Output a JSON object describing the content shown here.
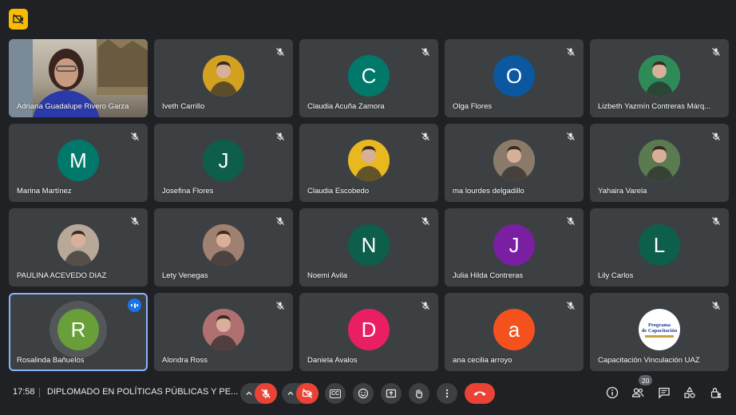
{
  "meeting": {
    "time": "17:58",
    "title": "DIPLOMADO EN POLÍTICAS PÚBLICAS Y PE...",
    "participant_count": "20"
  },
  "colors": {
    "background": "#202124",
    "tile": "#3c4043",
    "end_call": "#ea4335",
    "speaking_outline": "#8ab4f8",
    "speaking_badge": "#1a73e8"
  },
  "participants": [
    {
      "name": "Adriana Guadalupe Rivero Garza",
      "type": "video"
    },
    {
      "name": "Iveth Carrillo",
      "type": "photo",
      "photo_color": "#d4a020"
    },
    {
      "name": "Claudia Acuña Zamora",
      "type": "initial",
      "initial": "C",
      "color": "#00796b"
    },
    {
      "name": "Olga Flores",
      "type": "initial",
      "initial": "O",
      "color": "#0b57a0"
    },
    {
      "name": "Lizbeth Yazmín Contreras Márq...",
      "type": "photo",
      "photo_color": "#2e8b57"
    },
    {
      "name": "Marina Martínez",
      "type": "initial",
      "initial": "M",
      "color": "#00796b"
    },
    {
      "name": "Josefina Flores",
      "type": "initial",
      "initial": "J",
      "color": "#0d5e4a"
    },
    {
      "name": "Claudia Escobedo",
      "type": "photo",
      "photo_color": "#e8b820"
    },
    {
      "name": "ma lourdes delgadillo",
      "type": "photo",
      "photo_color": "#8a7a6a"
    },
    {
      "name": "Yahaira Varela",
      "type": "photo",
      "photo_color": "#5a7a50"
    },
    {
      "name": "PAULINA ACEVEDO DIAZ",
      "type": "photo",
      "photo_color": "#b8a898"
    },
    {
      "name": "Lety Venegas",
      "type": "photo",
      "photo_color": "#a08070"
    },
    {
      "name": "Noemi Avila",
      "type": "initial",
      "initial": "N",
      "color": "#0d5e4a"
    },
    {
      "name": "Julia Hilda Contreras",
      "type": "initial",
      "initial": "J",
      "color": "#7b1fa2"
    },
    {
      "name": "Lily Carlos",
      "type": "initial",
      "initial": "L",
      "color": "#0d5e4a"
    },
    {
      "name": "Rosalinda Bañuelos",
      "type": "initial",
      "initial": "R",
      "color": "#689f38",
      "speaking": true
    },
    {
      "name": "Alondra Ross",
      "type": "photo",
      "photo_color": "#b07070"
    },
    {
      "name": "Daniela Avalos",
      "type": "initial",
      "initial": "D",
      "color": "#e91e63"
    },
    {
      "name": "ana cecilia arroyo",
      "type": "initial",
      "initial": "a",
      "color": "#f4511e"
    },
    {
      "name": "Capacitación Vinculación UAZ",
      "type": "logo",
      "logo_text": "Programa de Capacitación",
      "photo_color": "#ffffff"
    }
  ],
  "controls": {
    "mic": "mic-off-icon",
    "camera": "camera-off-icon",
    "captions": "CC",
    "reactions": "emoji-icon",
    "present": "present-icon",
    "raise_hand": "hand-icon",
    "more": "more-vert-icon",
    "end_call": "call-end-icon"
  }
}
